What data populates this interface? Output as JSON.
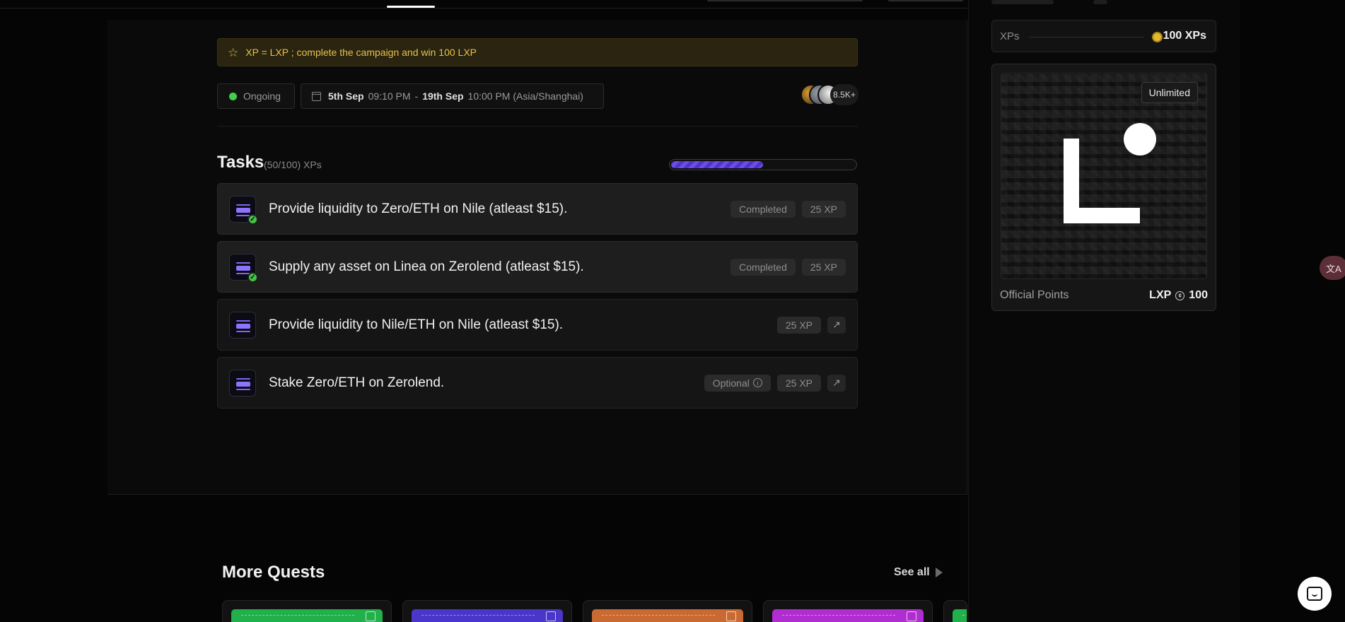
{
  "banner": {
    "text": "XP = LXP ; complete the campaign and win 100 LXP"
  },
  "campaign": {
    "status": "Ongoing",
    "start_date": "5th Sep",
    "start_time": "09:10 PM",
    "separator": "-",
    "end_date": "19th Sep",
    "end_time": "10:00 PM (Asia/Shanghai)",
    "participants": "8.5K+"
  },
  "tasks": {
    "title": "Tasks",
    "subtitle": "(50/100) XPs",
    "progress_fraction": 0.5,
    "items": [
      {
        "text": "Provide liquidity to Zero/ETH on Nile (atleast $15).",
        "status": "Completed",
        "xp": "25 XP",
        "completed": true
      },
      {
        "text": "Supply any asset on Linea on Zerolend (atleast $15).",
        "status": "Completed",
        "xp": "25 XP",
        "completed": true
      },
      {
        "text": "Provide liquidity to Nile/ETH on Nile (atleast $15).",
        "xp": "25 XP",
        "completed": false,
        "arrow": "↗"
      },
      {
        "text": "Stake Zero/ETH on Zerolend.",
        "optional": "Optional",
        "xp": "25 XP",
        "completed": false,
        "arrow": "↗"
      }
    ]
  },
  "sidebar": {
    "xp_label": "XPs",
    "xp_value": "100 XPs",
    "reward": {
      "badge": "Unlimited",
      "label": "Official Points",
      "token": "LXP",
      "amount": "100"
    }
  },
  "more_quests": {
    "title": "More Quests",
    "see_all": "See all",
    "cards": [
      {
        "color": "#22b04a"
      },
      {
        "color": "#4a36c8"
      },
      {
        "color": "#c86a32"
      },
      {
        "color": "#b02ed0"
      },
      {
        "color": "#22b04a"
      }
    ]
  },
  "colors": {
    "accent_purple": "#6d4ce8",
    "success_green": "#3fd04a",
    "banner_gold": "#e7c24a"
  },
  "icons": [
    "star-icon",
    "calendar-icon",
    "check-icon",
    "arrow-up-right-icon",
    "info-icon",
    "coin-icon",
    "translate-icon",
    "chat-icon"
  ]
}
